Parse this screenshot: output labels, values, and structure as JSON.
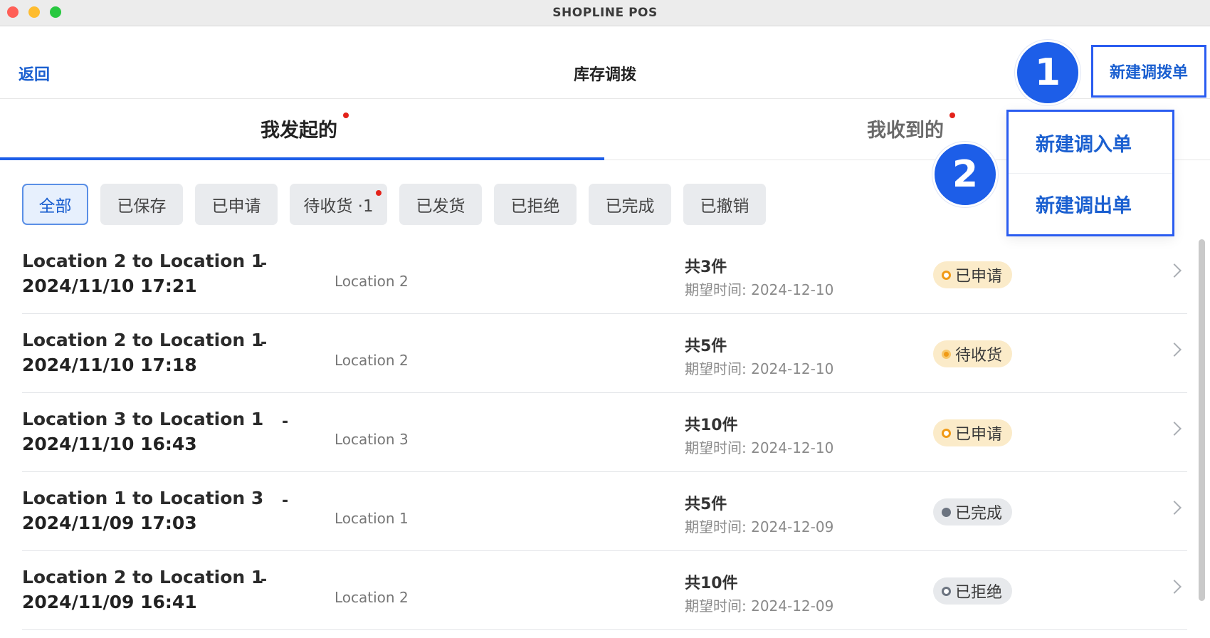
{
  "window": {
    "title": "SHOPLINE POS"
  },
  "header": {
    "back_label": "返回",
    "title": "库存调拨",
    "new_transfer_label": "新建调拨单"
  },
  "steps": {
    "one": "1",
    "two": "2"
  },
  "tabs": [
    {
      "label": "我发起的",
      "active": true,
      "has_dot": true
    },
    {
      "label": "我收到的",
      "active": false,
      "has_dot": true
    }
  ],
  "dropdown": {
    "items": [
      {
        "label": "新建调入单"
      },
      {
        "label": "新建调出单"
      }
    ]
  },
  "filters": [
    {
      "label": "全部",
      "active": true
    },
    {
      "label": "已保存"
    },
    {
      "label": "已申请"
    },
    {
      "label": "待收货 ·1",
      "has_dot": true
    },
    {
      "label": "已发货"
    },
    {
      "label": "已拒绝"
    },
    {
      "label": "已完成"
    },
    {
      "label": "已撤销"
    }
  ],
  "transfers": [
    {
      "title": "Location 2 to Location 1",
      "dash": "-",
      "datetime": "2024/11/10 17:21",
      "location": "Location 2",
      "qty": "共3件",
      "expected": "期望时间: 2024-12-10",
      "status": "已申请",
      "status_style": "applied"
    },
    {
      "title": "Location 2 to Location 1",
      "dash": "-",
      "datetime": "2024/11/10 17:18",
      "location": "Location 2",
      "qty": "共5件",
      "expected": "期望时间: 2024-12-10",
      "status": "待收货",
      "status_style": "pending"
    },
    {
      "title": "Location 3 to Location 1",
      "dash": "-",
      "datetime": "2024/11/10 16:43",
      "location": "Location 3",
      "qty": "共10件",
      "expected": "期望时间: 2024-12-10",
      "status": "已申请",
      "status_style": "applied"
    },
    {
      "title": "Location 1 to Location 3",
      "dash": "-",
      "datetime": "2024/11/09 17:03",
      "location": "Location 1",
      "qty": "共5件",
      "expected": "期望时间: 2024-12-09",
      "status": "已完成",
      "status_style": "completed"
    },
    {
      "title": "Location 2 to Location 1",
      "dash": "-",
      "datetime": "2024/11/09 16:41",
      "location": "Location 2",
      "qty": "共10件",
      "expected": "期望时间: 2024-12-09",
      "status": "已拒绝",
      "status_style": "rejected"
    }
  ],
  "colors": {
    "accent": "#1d5ee8",
    "link": "#1a5fd0",
    "badge_dot": "#e3221a",
    "status_warn_bg": "#fbebc9",
    "status_neutral_bg": "#e7e9ec",
    "status_orange": "#f09a16"
  },
  "icons": {
    "row_action": "chevron-right-icon"
  }
}
